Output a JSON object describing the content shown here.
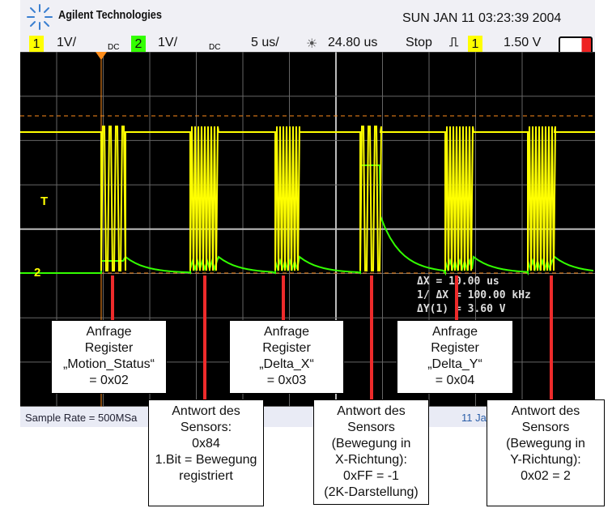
{
  "header": {
    "brand": "Agilent Technologies",
    "datetime": "SUN JAN 11 03:23:39 2004"
  },
  "settings": {
    "ch1": "1",
    "ch1_scale": "1V/",
    "ch1_coupling": "DC",
    "ch2": "2",
    "ch2_scale": "1V/",
    "ch2_coupling": "DC",
    "timebase": "5 us/",
    "delay": "24.80 us",
    "run_state": "Stop",
    "trigger_source": "1",
    "trigger_level": "1.50 V"
  },
  "colors": {
    "ch1": "#ffff00",
    "ch2": "#33ff00",
    "cursor": "#ff8c1a",
    "annotation_line": "#ee2b2b"
  },
  "markers": {
    "trigger": "T",
    "ch2_ground": "2"
  },
  "measurements": [
    "ΔX = 10.00 us",
    "1/ ΔX = 100.00 kHz",
    "ΔY(1) = 3.60 V"
  ],
  "status": {
    "sample_rate": "Sample Rate = 500MSa",
    "date": "11 Ja"
  },
  "annotations": [
    [
      "Anfrage",
      "Register",
      "„Motion_Status“",
      "= 0x02"
    ],
    [
      "Antwort des",
      "Sensors:",
      "0x84",
      "1.Bit = Bewegung",
      "registriert"
    ],
    [
      "Anfrage",
      "Register",
      "„Delta_X“",
      "= 0x03"
    ],
    [
      "Antwort des",
      "Sensors",
      "(Bewegung in",
      "X-Richtung):",
      "0xFF = -1",
      "(2K-Darstellung)"
    ],
    [
      "Anfrage",
      "Register",
      "„Delta_Y“",
      "= 0x04"
    ],
    [
      "Antwort des",
      "Sensors",
      "(Bewegung in",
      "Y-Richtung):",
      "0x02 = 2"
    ]
  ]
}
